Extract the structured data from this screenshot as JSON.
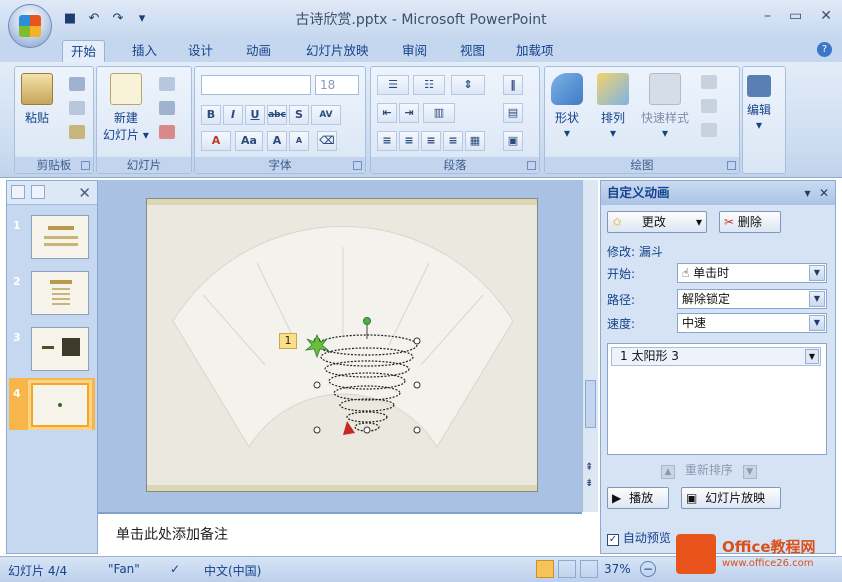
{
  "window": {
    "title": "古诗欣赏.pptx - Microsoft PowerPoint"
  },
  "qat": {
    "save_icon": "save-icon",
    "undo_icon": "undo-icon",
    "redo_icon": "redo-icon",
    "customize": "▾"
  },
  "tabs": [
    "开始",
    "插入",
    "设计",
    "动画",
    "幻灯片放映",
    "审阅",
    "视图",
    "加载项"
  ],
  "ribbon": {
    "clipboard": {
      "paste": "粘贴",
      "label": "剪贴板"
    },
    "slides": {
      "new_slide_line1": "新建",
      "new_slide_line2": "幻灯片 ▾",
      "label": "幻灯片"
    },
    "font": {
      "size": "18",
      "label": "字体",
      "buttons": [
        "B",
        "I",
        "U",
        "abc",
        "S",
        "AV"
      ],
      "grow": "A",
      "shrink": "A",
      "color": "A",
      "case": "Aa"
    },
    "paragraph": {
      "label": "段落"
    },
    "drawing": {
      "shapes": "形状",
      "arrange": "排列",
      "quick_styles": "快速样式",
      "label": "绘图"
    },
    "editing": {
      "edit": "编辑"
    }
  },
  "slides_panel": {
    "thumbnails": [
      "1",
      "2",
      "3",
      "4"
    ],
    "active_index": 4
  },
  "slide": {
    "effect_tag": "1"
  },
  "notes": {
    "placeholder": "单击此处添加备注"
  },
  "taskpane": {
    "title": "自定义动画",
    "change_button": "更改",
    "delete_button": "删除",
    "modify_label": "修改: 漏斗",
    "start_label": "开始:",
    "start_value": "单击时",
    "path_label": "路径:",
    "path_value": "解除锁定",
    "speed_label": "速度:",
    "speed_value": "中速",
    "list_item": "1   太阳形 3",
    "reorder": "重新排序",
    "play_button": "播放",
    "slideshow_button": "幻灯片放映",
    "autopreview": "自动预览"
  },
  "status": {
    "slide_info": "幻灯片 4/4",
    "theme": "\"Fan\"",
    "language": "中文(中国)",
    "zoom": "37%"
  },
  "watermark": {
    "text1": "Office教程网",
    "text2": "www.office26.com"
  },
  "colors": {
    "accent": "#15428b",
    "ribbon": "#dae6f5",
    "selected_thumb": "#f6a623"
  }
}
